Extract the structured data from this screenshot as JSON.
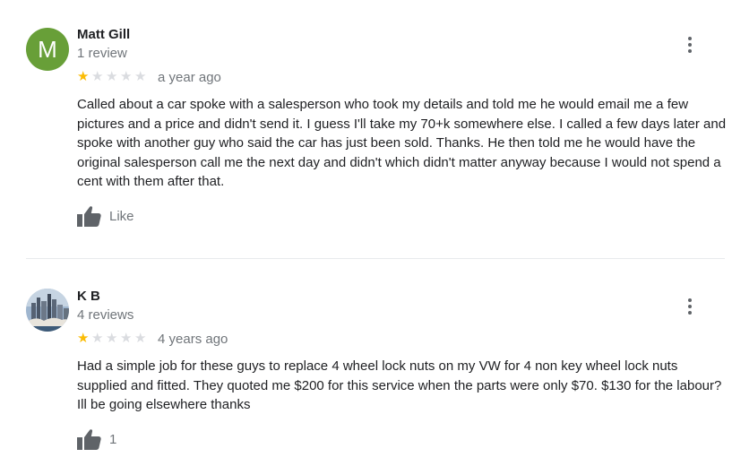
{
  "colors": {
    "avatar_bg": "#689f38",
    "star_filled": "#fbbc04",
    "star_empty": "#dadce0",
    "muted_text": "#70757a",
    "icon": "#5f6368"
  },
  "reviews": [
    {
      "avatar_letter": "M",
      "name": "Matt Gill",
      "review_count": "1 review",
      "rating": 1,
      "max_rating": 5,
      "time": "a year ago",
      "text": "Called about a car spoke with a salesperson who took my details and told me he would email me a few pictures and a price and didn't send it. I guess I'll take my 70+k somewhere else. I called a few  days later and spoke with another guy who said the car has just been sold. Thanks. He then  told me he would have the original salesperson call me the next day and didn't which didn't matter anyway because I would not spend a cent with them after that.",
      "like_label": "Like",
      "menu_icon": "more-vert-icon",
      "like_icon": "thumbs-up-icon"
    },
    {
      "avatar_icon": "city-skyline-photo",
      "name": "K B",
      "review_count": "4 reviews",
      "rating": 1,
      "max_rating": 5,
      "time": "4 years ago",
      "text": "Had a simple job for these guys to replace 4 wheel lock nuts on my VW for 4 non key wheel lock nuts supplied and fitted. They quoted me $200 for this service when the parts were only $70. $130 for the labour? Ill be going elsewhere thanks",
      "like_label": "1",
      "menu_icon": "more-vert-icon",
      "like_icon": "thumbs-up-icon"
    }
  ]
}
